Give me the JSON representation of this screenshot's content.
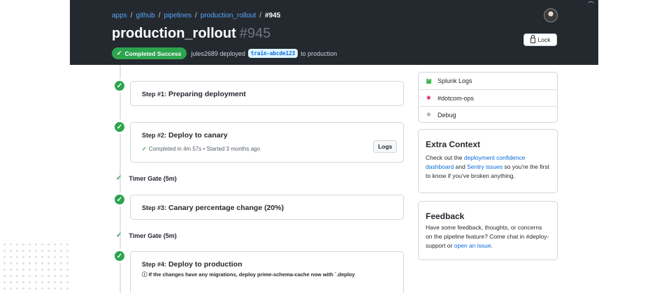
{
  "breadcrumb": {
    "items": [
      "apps",
      "github",
      "pipelines",
      "production_rollout"
    ],
    "current": "#945"
  },
  "header": {
    "title": "production_rollout",
    "number": "#945",
    "status_badge": "Completed Success",
    "deploy_text": "jules2689 deployed",
    "branch": "train-abcde123",
    "target_text": "to production",
    "lock_label": "Lock"
  },
  "steps": [
    {
      "label": "Step #1:",
      "name": "Preparing deployment"
    },
    {
      "label": "Step #2:",
      "name": "Deploy to canary",
      "meta": "Completed in 4m 57s • Started 3 months ago",
      "logs_label": "Logs"
    },
    {
      "label": "Step #3:",
      "name": "Canary percentage change (20%)"
    },
    {
      "label": "Step #4:",
      "name": "Deploy to production",
      "note": "ⓘ If the changes have any migrations, deploy prime-schema-cache now with `.deploy"
    }
  ],
  "gates": [
    "Timer Gate (5m)",
    "Timer Gate (5m)"
  ],
  "sidebar": {
    "links": [
      {
        "label": "Splunk Logs",
        "icon": "splunk-icon"
      },
      {
        "label": "#dotcom-ops",
        "icon": "slack-icon"
      },
      {
        "label": "Debug",
        "icon": "debug-icon"
      }
    ],
    "extra_context": {
      "title": "Extra Context",
      "text_1": "Check out the ",
      "link_1": "deployment confidence dashboard",
      "text_2": " and ",
      "link_2": "Sentry issues",
      "text_3": " so you're the first to know if you've broken anything."
    },
    "feedback": {
      "title": "Feedback",
      "text_1": "Have some feedback, thoughts, or concerns on the pipeline feature? Come chat in #deploy-support or ",
      "link": "open an issue",
      "text_2": "."
    }
  },
  "colors": {
    "header_bg": "#24292f",
    "success": "#2da44e",
    "link": "#0969da"
  }
}
